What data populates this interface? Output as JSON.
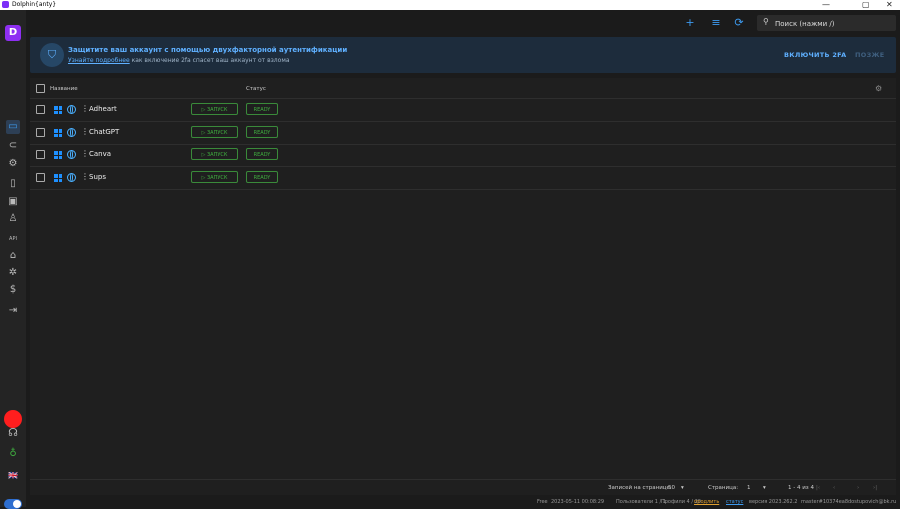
{
  "window": {
    "title": "Dolphin{anty}",
    "min": "—",
    "max": "▢",
    "close": "✕"
  },
  "sidebar": {
    "logo": "D",
    "items": [
      {
        "name": "profiles-icon",
        "glyph": "▭"
      },
      {
        "name": "proxies-icon",
        "glyph": "⊂"
      },
      {
        "name": "scenarios-icon",
        "glyph": "⚙"
      },
      {
        "name": "bookmarks-icon",
        "glyph": "▯"
      },
      {
        "name": "extensions-icon",
        "glyph": "▣"
      },
      {
        "name": "team-icon",
        "glyph": "♙"
      },
      {
        "name": "api-icon",
        "glyph": "API"
      },
      {
        "name": "home-icon",
        "glyph": "⌂"
      },
      {
        "name": "settings-icon",
        "glyph": "✲"
      },
      {
        "name": "billing-icon",
        "glyph": "$"
      },
      {
        "name": "logout-icon",
        "glyph": "⇥"
      }
    ],
    "support": "☊",
    "idea": "♁",
    "lang": "🇬🇧"
  },
  "topbar": {
    "add": "+",
    "filter": "≡",
    "refresh": "⟳",
    "search_placeholder": "Поиск (нажми /)"
  },
  "banner": {
    "title": "Защитите ваш аккаунт с помощью двухфакторной аутентификации",
    "link": "Узнайте подробнее",
    "subtitle": " как включение 2fa спасет ваш аккаунт от взлома",
    "enable": "ВКЛЮЧИТЬ 2FA",
    "later": "ПОЗЖЕ"
  },
  "table": {
    "col_name": "Название",
    "col_status": "Статус",
    "rows": [
      {
        "name": "Adheart",
        "run": "▷ ЗАПУСК",
        "status": "READY"
      },
      {
        "name": "ChatGPT",
        "run": "▷ ЗАПУСК",
        "status": "READY"
      },
      {
        "name": "Canva",
        "run": "▷ ЗАПУСК",
        "status": "READY"
      },
      {
        "name": "Sups",
        "run": "▷ ЗАПУСК",
        "status": "READY"
      }
    ]
  },
  "pager": {
    "per_page_label": "Записей на странице:",
    "per_page": "50",
    "page_label": "Страница:",
    "page": "1",
    "range": "1 - 4 из 4"
  },
  "status": {
    "plan": "Free",
    "date": "2023-05-11 00:08:29",
    "users": "Пользователи 1 / 1",
    "profiles": "Профили 4 / 20",
    "extend": "продлить",
    "changelog": "статус",
    "version": "версия 2023.262.2",
    "build": "master#10374ea8",
    "email": "dostupovich@bk.ru"
  },
  "colors": {
    "accent": "#3d9bf0",
    "brand": "#8e2ff2",
    "success": "#3fae3f",
    "warning": "#e0a030"
  }
}
